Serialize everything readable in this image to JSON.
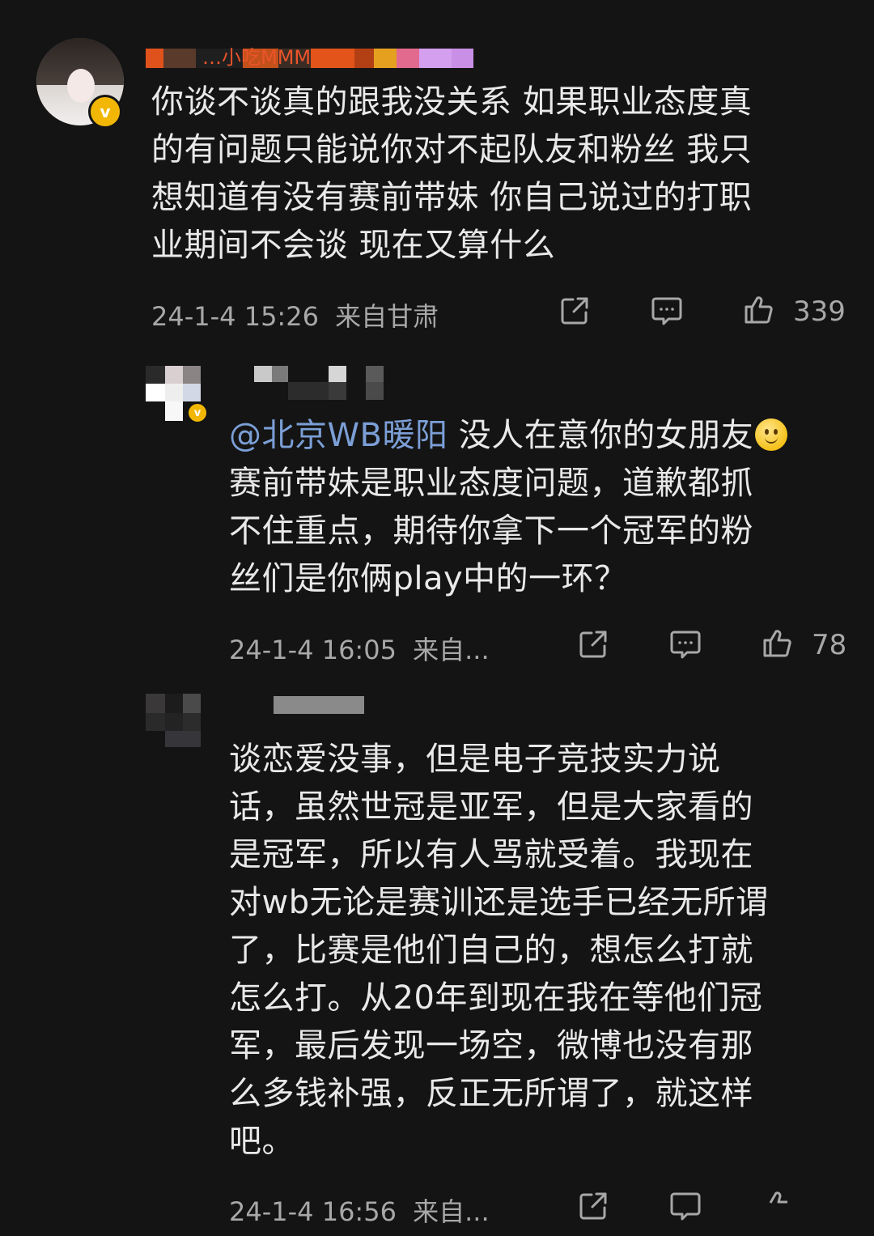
{
  "comments": [
    {
      "username": "…小吃MMM",
      "text": "你谈不谈真的跟我没关系 如果职业态度真\n的有问题只能说你对不起队友和粉丝 我只\n想知道有没有赛前带妹 你自己说过的打职\n业期间不会谈 现在又算什么",
      "timestamp": "24-1-4 15:26",
      "location": "来自甘肃",
      "likes": "339",
      "verified_mark": "v"
    },
    {
      "mention": "@北京WB暖阳",
      "text_first_line": " 没人在意你的女朋友",
      "text": "赛前带妹是职业态度问题，道歉都抓\n不住重点，期待你拿下一个冠军的粉\n丝们是你俩play中的一环？",
      "timestamp": "24-1-4 16:05",
      "location": "来自...",
      "likes": "78",
      "verified_mark": "v"
    },
    {
      "text": "谈恋爱没事，但是电子竞技实力说\n话，虽然世冠是亚军，但是大家看的\n是冠军，所以有人骂就受着。我现在\n对wb无论是赛训还是选手已经无所谓\n了，比赛是他们自己的，想怎么打就\n怎么打。从20年到现在我在等他们冠\n军，最后发现一场空，微博也没有那\n么多钱补强，反正无所谓了，就这样\n吧。",
      "timestamp": "24-1-4 16:56",
      "location": "来自..."
    }
  ],
  "icons": {
    "share": "share-icon",
    "comment": "comment-icon",
    "like": "thumbs-up-icon"
  },
  "colors": {
    "background": "#141414",
    "text": "#e9e9e9",
    "meta": "#a8a8a8",
    "mention": "#7b9fd6",
    "verified": "#f2b705"
  }
}
